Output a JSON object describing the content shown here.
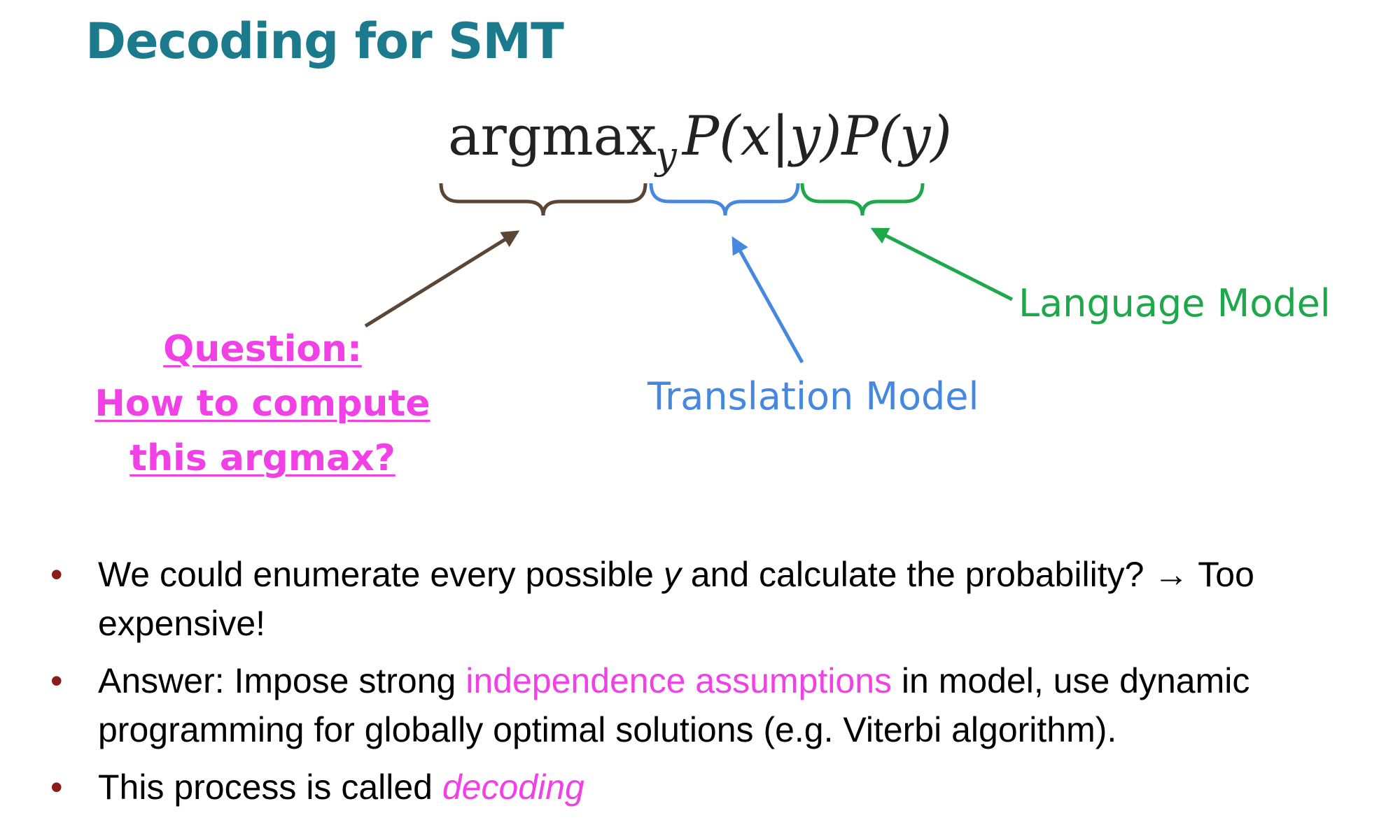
{
  "title": "Decoding for SMT",
  "formula": {
    "argmax": "argmax",
    "subscript": "y",
    "translation_term": "P(x|y)",
    "language_term": "P(y)"
  },
  "labels": {
    "language_model": "Language Model",
    "translation_model": "Translation Model"
  },
  "question": {
    "line1": "Question:",
    "line2": "How to compute",
    "line3": "this argmax?"
  },
  "bullets": [
    {
      "part1": "We could enumerate every possible ",
      "emph": "y",
      "part2": " and calculate the probability? → Too expensive!"
    },
    {
      "part1": "Answer: Impose strong ",
      "highlight": "independence assumptions",
      "part2": " in model, use dynamic programming for globally optimal solutions (e.g. Viterbi algorithm)."
    },
    {
      "part1": "This process is called ",
      "highlight": "decoding"
    }
  ],
  "colors": {
    "title": "#1b7b8d",
    "argmax_brace": "#5a4636",
    "translation_model": "#4688e0",
    "language_model": "#1fa84b",
    "highlight": "#f040e6",
    "bullet_dot": "#8b1c1c"
  }
}
